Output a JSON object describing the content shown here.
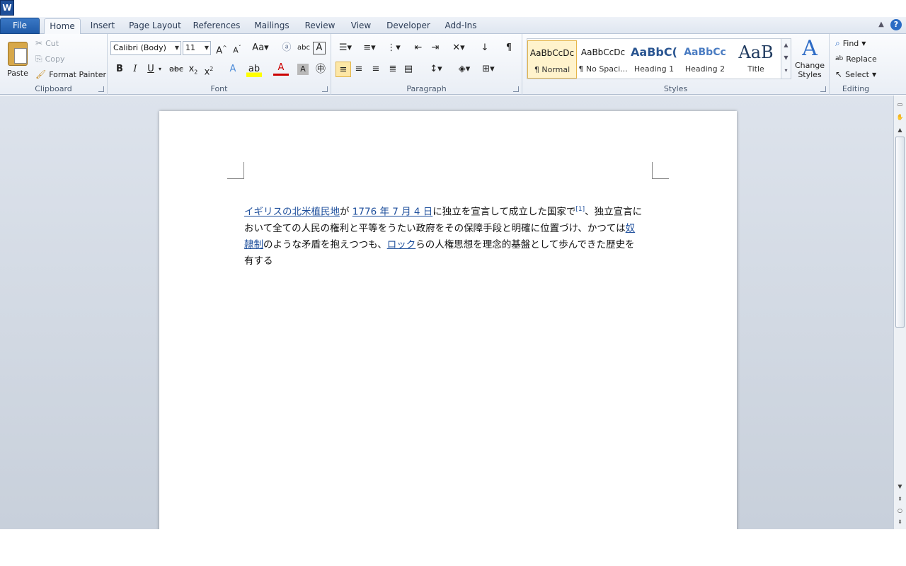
{
  "app_icon": "W",
  "tabs": [
    "File",
    "Home",
    "Insert",
    "Page Layout",
    "References",
    "Mailings",
    "Review",
    "View",
    "Developer",
    "Add-Ins"
  ],
  "clipboard": {
    "paste": "Paste",
    "cut": "Cut",
    "copy": "Copy",
    "format_painter": "Format Painter",
    "label": "Clipboard"
  },
  "font": {
    "name": "Calibri (Body)",
    "size": "11",
    "label": "Font"
  },
  "paragraph": {
    "label": "Paragraph"
  },
  "styles": {
    "label": "Styles",
    "items": [
      {
        "sample": "AaBbCcDc",
        "name": "¶ Normal"
      },
      {
        "sample": "AaBbCcDc",
        "name": "¶ No Spaci..."
      },
      {
        "sample": "AaBbC(",
        "name": "Heading 1"
      },
      {
        "sample": "AaBbCc",
        "name": "Heading 2"
      },
      {
        "sample": "AaB",
        "name": "Title"
      }
    ],
    "change_styles": "Change Styles"
  },
  "editing": {
    "find": "Find",
    "replace": "Replace",
    "select": "Select",
    "label": "Editing"
  },
  "document": {
    "link1": "イギリスの北米植民地",
    "t1": "が",
    "link2": "1776 年 7 月 4 日",
    "t2": "に独立を宣言して成立した国家で",
    "ref": "[1]",
    "t3": "、独立宣言において全ての人民の権利と平等をうたい政府をその保障手段と明確に位置づけ、かつては",
    "link3": "奴隷制",
    "t4": "のような矛盾を抱えつつも、",
    "link4": "ロック",
    "t5": "らの人権思想を理念的基盤として歩んできた歴史を有する"
  }
}
